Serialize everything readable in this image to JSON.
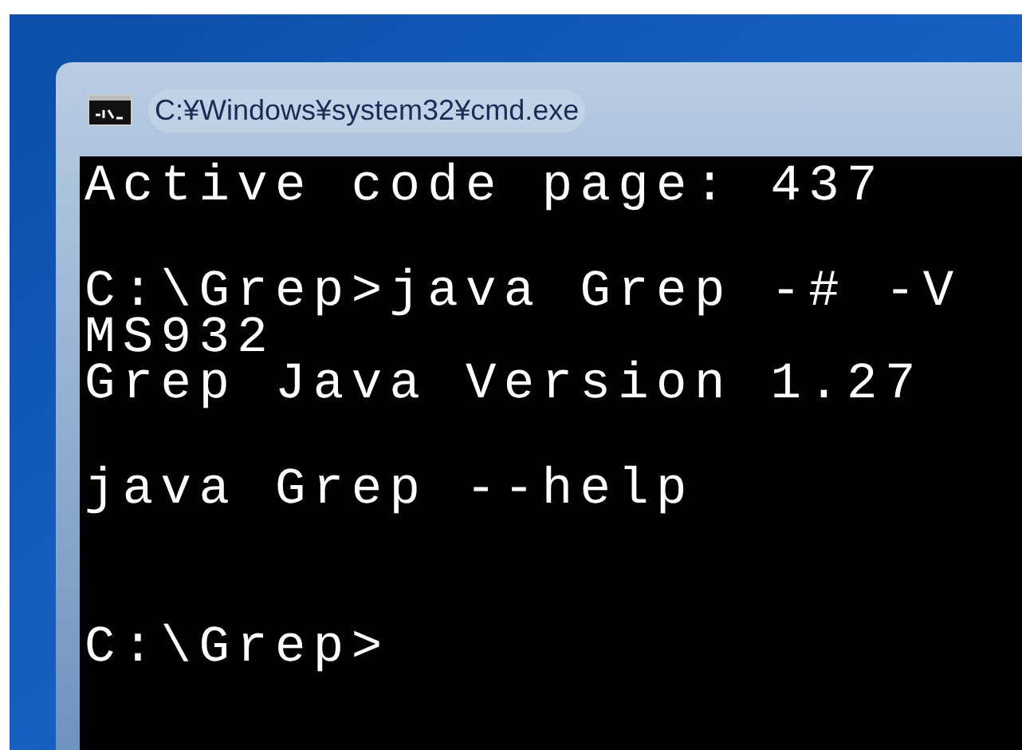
{
  "window": {
    "title": "C:¥Windows¥system32¥cmd.exe"
  },
  "console": {
    "lines": [
      {
        "kind": "text",
        "text": "Active code page: 437"
      },
      {
        "kind": "blank"
      },
      {
        "kind": "text",
        "text": "C:\\Grep>java Grep -# -V"
      },
      {
        "kind": "tight",
        "text": "MS932"
      },
      {
        "kind": "text",
        "text": "Grep Java Version 1.27"
      },
      {
        "kind": "blank"
      },
      {
        "kind": "text",
        "text": "java Grep --help"
      },
      {
        "kind": "blank"
      },
      {
        "kind": "blank"
      },
      {
        "kind": "text",
        "text": "C:\\Grep>"
      }
    ]
  }
}
